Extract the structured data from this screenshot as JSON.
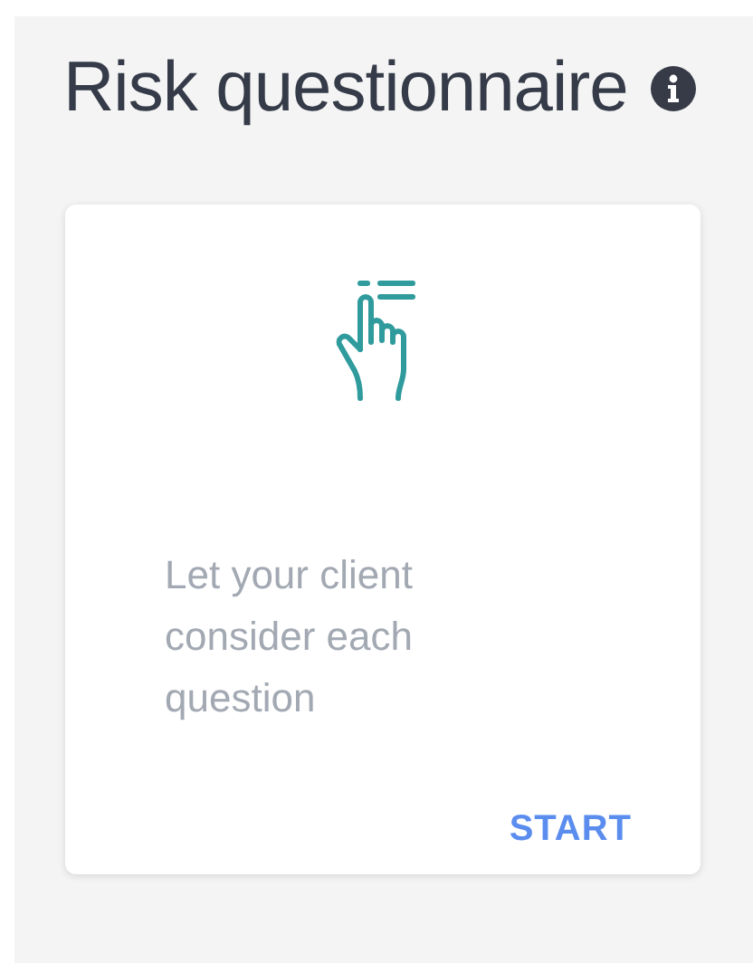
{
  "title": "Risk questionnaire",
  "card": {
    "description": "Let your client consider each question",
    "action": "START"
  }
}
